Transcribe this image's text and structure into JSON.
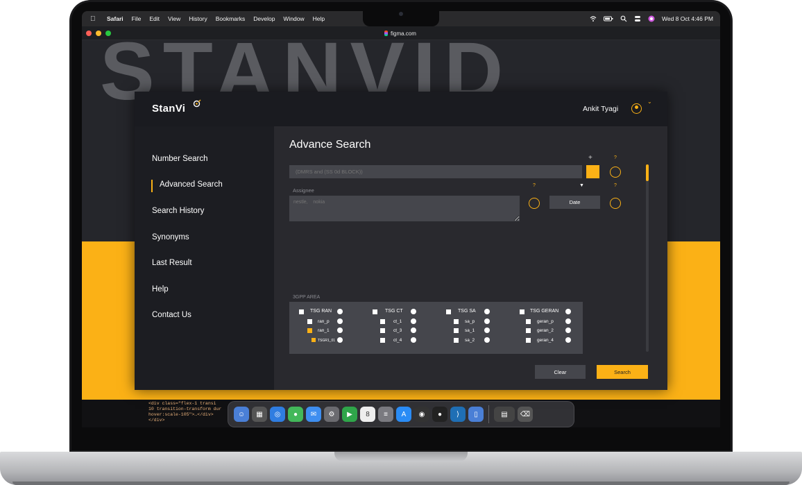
{
  "menubar": {
    "app": "Safari",
    "items": [
      "File",
      "Edit",
      "View",
      "History",
      "Bookmarks",
      "Develop",
      "Window",
      "Help"
    ],
    "clock": "Wed 8 Oct  4:46 PM"
  },
  "browser": {
    "url": "figma.com"
  },
  "background": {
    "big_text": "STANVID"
  },
  "app": {
    "logo": "StanVi",
    "user_name": "Ankit Tyagi",
    "nav": [
      "Number Search",
      "Advanced Search",
      "Search History",
      "Synonyms",
      "Last Result",
      "Help",
      "Contact Us"
    ],
    "active_nav": "Advanced Search",
    "page_title": "Advance Search",
    "query_placeholder": "(DMRS and (SS 0d BLOCK))",
    "plus_label": "+",
    "question_mark": "?",
    "assignee_label": "Assignee",
    "assignee_placeholder": "nestle,    nokia",
    "date_label": "Date",
    "area_label": "3GPP AREA",
    "groups": [
      {
        "name": "TSG RAN",
        "items": [
          "ran_p",
          "ran_1",
          "TSGR1_01"
        ]
      },
      {
        "name": "TSG CT",
        "items": [
          "ct_1",
          "ct_3",
          "ct_4"
        ]
      },
      {
        "name": "TSG SA",
        "items": [
          "sa_p",
          "sa_1",
          "sa_2"
        ]
      },
      {
        "name": "TSG GERAN",
        "items": [
          "geran_p",
          "geran_2",
          "geran_4"
        ]
      }
    ],
    "clear_label": "Clear",
    "search_label": "Search"
  },
  "devtools_code": [
    "<div class=\"flex-1 transi",
    "10 transition-transform dur",
    "hover:scale-105\">…</div>",
    "</div>"
  ],
  "colors": {
    "accent": "#fbb116",
    "panel": "#29292e",
    "sidebar": "#1c1d22",
    "input": "#45464c"
  }
}
